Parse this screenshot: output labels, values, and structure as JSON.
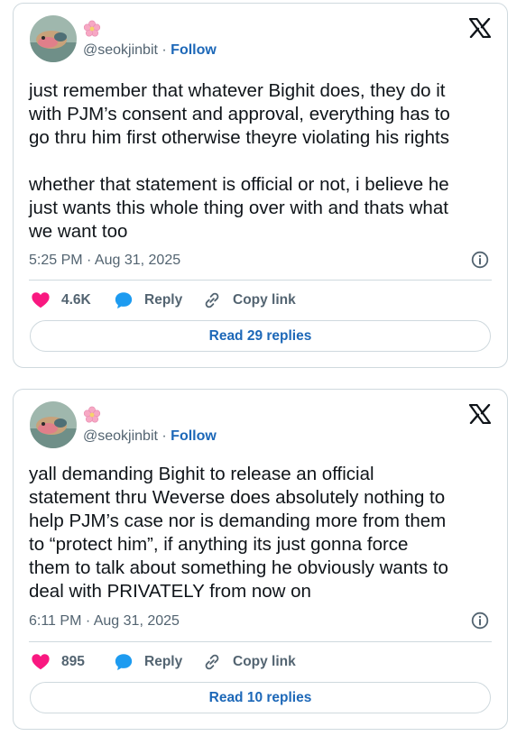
{
  "tweets": [
    {
      "handle": "@seokjinbit",
      "separator": " · ",
      "follow_label": "Follow",
      "text": "just remember that whatever Bighit does, they do it\nwith PJM’s consent and approval, everything has to\ngo thru him first otherwise theyre violating his rights\n\nwhether that statement is official or not, i believe he\njust wants this whole thing over with and thats what\nwe want too",
      "timestamp": "5:25 PM · Aug 31, 2025",
      "likes": "4.6K",
      "reply_label": "Reply",
      "copy_label": "Copy link",
      "read_replies": "Read 29 replies"
    },
    {
      "handle": "@seokjinbit",
      "separator": " · ",
      "follow_label": "Follow",
      "text": "yall demanding Bighit to release an official\nstatement thru Weverse does absolutely nothing to\nhelp PJM’s case nor is demanding more from them\nto “protect him”, if anything its just gonna force\nthem to talk about something he obviously wants to\ndeal with PRIVATELY from now on",
      "timestamp": "6:11 PM · Aug 31, 2025",
      "likes": "895",
      "reply_label": "Reply",
      "copy_label": "Copy link",
      "read_replies": "Read 10 replies"
    }
  ],
  "icons": {
    "platform": "x-logo-icon",
    "badge": "cherry-blossom-icon",
    "like": "heart-icon",
    "reply": "speech-bubble-icon",
    "copy": "link-icon",
    "info": "info-icon"
  },
  "colors": {
    "like": "#f91880",
    "reply": "#1d9bf0",
    "accent": "#1d68b8",
    "muted": "#536471",
    "border": "#cfd9de"
  }
}
